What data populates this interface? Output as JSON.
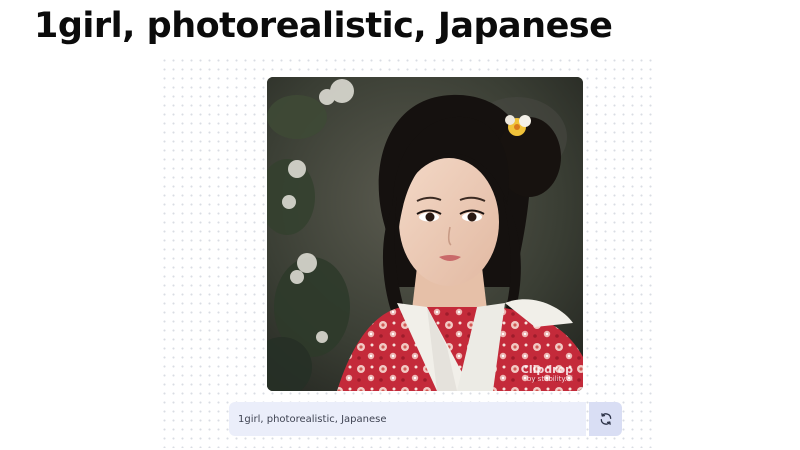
{
  "headline": "1girl, photorealistic, Japanese",
  "prompt": {
    "value": "1girl, photorealistic, Japanese"
  },
  "image": {
    "watermark_main": "Clipdrop",
    "watermark_sub": "by stability.ai"
  },
  "regenerate": {
    "icon": "refresh-icon"
  },
  "colors": {
    "prompt_bg": "#ebeefa",
    "button_bg": "#d9def4",
    "kimono_red": "#c7283a",
    "collar_white": "#f1efe9"
  }
}
